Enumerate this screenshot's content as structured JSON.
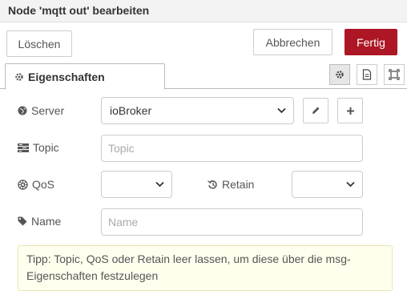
{
  "dialog": {
    "title": "Node 'mqtt out' bearbeiten"
  },
  "buttons": {
    "delete": "Löschen",
    "cancel": "Abbrechen",
    "done": "Fertig"
  },
  "tabs": {
    "properties": "Eigenschaften",
    "icons": [
      "gear-icon",
      "description-icon",
      "appearance-icon"
    ]
  },
  "form": {
    "server": {
      "label": "Server",
      "value": "ioBroker"
    },
    "topic": {
      "label": "Topic",
      "placeholder": "Topic",
      "value": ""
    },
    "qos": {
      "label": "QoS",
      "value": ""
    },
    "retain": {
      "label": "Retain",
      "value": ""
    },
    "name": {
      "label": "Name",
      "placeholder": "Name",
      "value": ""
    }
  },
  "tip": "Tipp: Topic, QoS oder Retain leer lassen, um diese über die msg-Eigenschaften festzulegen",
  "colors": {
    "primary": "#ad1625",
    "tip_bg": "#ffffee"
  }
}
